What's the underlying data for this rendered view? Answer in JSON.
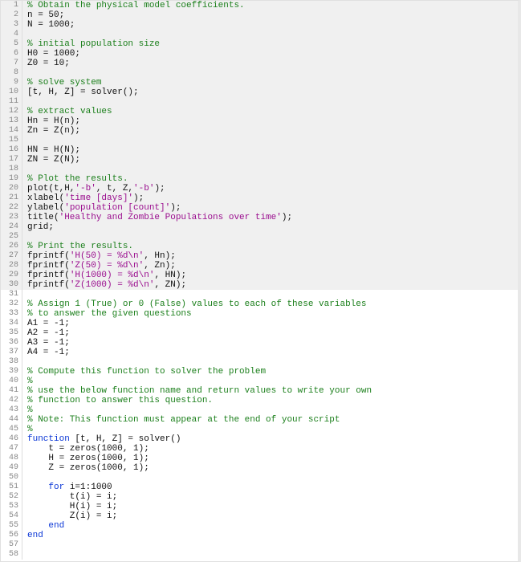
{
  "editor": {
    "lines": [
      {
        "n": 1,
        "shaded": true,
        "tokens": [
          [
            "comment",
            "% Obtain the physical model coefficients."
          ]
        ]
      },
      {
        "n": 2,
        "shaded": true,
        "tokens": [
          [
            "default",
            "n = 50;"
          ]
        ]
      },
      {
        "n": 3,
        "shaded": true,
        "tokens": [
          [
            "default",
            "N = 1000;"
          ]
        ]
      },
      {
        "n": 4,
        "shaded": true,
        "tokens": []
      },
      {
        "n": 5,
        "shaded": true,
        "tokens": [
          [
            "comment",
            "% initial population size"
          ]
        ]
      },
      {
        "n": 6,
        "shaded": true,
        "tokens": [
          [
            "default",
            "H0 = 1000;"
          ]
        ]
      },
      {
        "n": 7,
        "shaded": true,
        "tokens": [
          [
            "default",
            "Z0 = 10;"
          ]
        ]
      },
      {
        "n": 8,
        "shaded": true,
        "tokens": []
      },
      {
        "n": 9,
        "shaded": true,
        "tokens": [
          [
            "comment",
            "% solve system"
          ]
        ]
      },
      {
        "n": 10,
        "shaded": true,
        "tokens": [
          [
            "default",
            "[t, H, Z] = solver();"
          ]
        ]
      },
      {
        "n": 11,
        "shaded": true,
        "tokens": []
      },
      {
        "n": 12,
        "shaded": true,
        "tokens": [
          [
            "comment",
            "% extract values"
          ]
        ]
      },
      {
        "n": 13,
        "shaded": true,
        "tokens": [
          [
            "default",
            "Hn = H(n);"
          ]
        ]
      },
      {
        "n": 14,
        "shaded": true,
        "tokens": [
          [
            "default",
            "Zn = Z(n);"
          ]
        ]
      },
      {
        "n": 15,
        "shaded": true,
        "tokens": []
      },
      {
        "n": 16,
        "shaded": true,
        "tokens": [
          [
            "default",
            "HN = H(N);"
          ]
        ]
      },
      {
        "n": 17,
        "shaded": true,
        "tokens": [
          [
            "default",
            "ZN = Z(N);"
          ]
        ]
      },
      {
        "n": 18,
        "shaded": true,
        "tokens": []
      },
      {
        "n": 19,
        "shaded": true,
        "tokens": [
          [
            "comment",
            "% Plot the results."
          ]
        ]
      },
      {
        "n": 20,
        "shaded": true,
        "tokens": [
          [
            "default",
            "plot(t,H,"
          ],
          [
            "string",
            "'-b'"
          ],
          [
            "default",
            ", t, Z,"
          ],
          [
            "string",
            "'-b'"
          ],
          [
            "default",
            ");"
          ]
        ]
      },
      {
        "n": 21,
        "shaded": true,
        "tokens": [
          [
            "default",
            "xlabel("
          ],
          [
            "string",
            "'time [days]'"
          ],
          [
            "default",
            ");"
          ]
        ]
      },
      {
        "n": 22,
        "shaded": true,
        "tokens": [
          [
            "default",
            "ylabel("
          ],
          [
            "string",
            "'population [count]'"
          ],
          [
            "default",
            ");"
          ]
        ]
      },
      {
        "n": 23,
        "shaded": true,
        "tokens": [
          [
            "default",
            "title("
          ],
          [
            "string",
            "'Healthy and Zombie Populations over time'"
          ],
          [
            "default",
            ");"
          ]
        ]
      },
      {
        "n": 24,
        "shaded": true,
        "tokens": [
          [
            "default",
            "grid;"
          ]
        ]
      },
      {
        "n": 25,
        "shaded": true,
        "tokens": []
      },
      {
        "n": 26,
        "shaded": true,
        "tokens": [
          [
            "comment",
            "% Print the results."
          ]
        ]
      },
      {
        "n": 27,
        "shaded": true,
        "tokens": [
          [
            "default",
            "fprintf("
          ],
          [
            "string",
            "'H(50) = %d\\n'"
          ],
          [
            "default",
            ", Hn);"
          ]
        ]
      },
      {
        "n": 28,
        "shaded": true,
        "tokens": [
          [
            "default",
            "fprintf("
          ],
          [
            "string",
            "'Z(50) = %d\\n'"
          ],
          [
            "default",
            ", Zn);"
          ]
        ]
      },
      {
        "n": 29,
        "shaded": true,
        "tokens": [
          [
            "default",
            "fprintf("
          ],
          [
            "string",
            "'H(1000) = %d\\n'"
          ],
          [
            "default",
            ", HN);"
          ]
        ]
      },
      {
        "n": 30,
        "shaded": true,
        "tokens": [
          [
            "default",
            "fprintf("
          ],
          [
            "string",
            "'Z(1000) = %d\\n'"
          ],
          [
            "default",
            ", ZN);"
          ]
        ]
      },
      {
        "n": 31,
        "shaded": false,
        "tokens": []
      },
      {
        "n": 32,
        "shaded": false,
        "tokens": [
          [
            "comment",
            "% Assign 1 (True) or 0 (False) values to each of these variables"
          ]
        ]
      },
      {
        "n": 33,
        "shaded": false,
        "tokens": [
          [
            "comment",
            "% to answer the given questions"
          ]
        ]
      },
      {
        "n": 34,
        "shaded": false,
        "tokens": [
          [
            "default",
            "A1 = -1;"
          ]
        ]
      },
      {
        "n": 35,
        "shaded": false,
        "tokens": [
          [
            "default",
            "A2 = -1;"
          ]
        ]
      },
      {
        "n": 36,
        "shaded": false,
        "tokens": [
          [
            "default",
            "A3 = -1;"
          ]
        ]
      },
      {
        "n": 37,
        "shaded": false,
        "tokens": [
          [
            "default",
            "A4 = -1;"
          ]
        ]
      },
      {
        "n": 38,
        "shaded": false,
        "tokens": []
      },
      {
        "n": 39,
        "shaded": false,
        "tokens": [
          [
            "comment",
            "% Compute this function to solver the problem"
          ]
        ]
      },
      {
        "n": 40,
        "shaded": false,
        "tokens": [
          [
            "comment",
            "%"
          ]
        ]
      },
      {
        "n": 41,
        "shaded": false,
        "tokens": [
          [
            "comment",
            "% use the below function name and return values to write your own"
          ]
        ]
      },
      {
        "n": 42,
        "shaded": false,
        "tokens": [
          [
            "comment",
            "% function to answer this question."
          ]
        ]
      },
      {
        "n": 43,
        "shaded": false,
        "tokens": [
          [
            "comment",
            "%"
          ]
        ]
      },
      {
        "n": 44,
        "shaded": false,
        "tokens": [
          [
            "comment",
            "% Note: This function must appear at the end of your script"
          ]
        ]
      },
      {
        "n": 45,
        "shaded": false,
        "tokens": [
          [
            "comment",
            "%"
          ]
        ]
      },
      {
        "n": 46,
        "shaded": false,
        "tokens": [
          [
            "keyword",
            "function "
          ],
          [
            "default",
            "[t, H, Z] = solver()"
          ]
        ]
      },
      {
        "n": 47,
        "shaded": false,
        "tokens": [
          [
            "default",
            "    t = zeros(1000, 1);"
          ]
        ]
      },
      {
        "n": 48,
        "shaded": false,
        "tokens": [
          [
            "default",
            "    H = zeros(1000, 1);"
          ]
        ]
      },
      {
        "n": 49,
        "shaded": false,
        "tokens": [
          [
            "default",
            "    Z = zeros(1000, 1);"
          ]
        ]
      },
      {
        "n": 50,
        "shaded": false,
        "tokens": []
      },
      {
        "n": 51,
        "shaded": false,
        "tokens": [
          [
            "default",
            "    "
          ],
          [
            "keyword",
            "for "
          ],
          [
            "default",
            "i=1:1000"
          ]
        ]
      },
      {
        "n": 52,
        "shaded": false,
        "tokens": [
          [
            "default",
            "        t(i) = i;"
          ]
        ]
      },
      {
        "n": 53,
        "shaded": false,
        "tokens": [
          [
            "default",
            "        H(i) = i;"
          ]
        ]
      },
      {
        "n": 54,
        "shaded": false,
        "tokens": [
          [
            "default",
            "        Z(i) = i;"
          ]
        ]
      },
      {
        "n": 55,
        "shaded": false,
        "tokens": [
          [
            "default",
            "    "
          ],
          [
            "keyword",
            "end"
          ]
        ]
      },
      {
        "n": 56,
        "shaded": false,
        "tokens": [
          [
            "keyword",
            "end"
          ]
        ]
      },
      {
        "n": 57,
        "shaded": false,
        "tokens": []
      },
      {
        "n": 58,
        "shaded": false,
        "tokens": []
      }
    ]
  }
}
